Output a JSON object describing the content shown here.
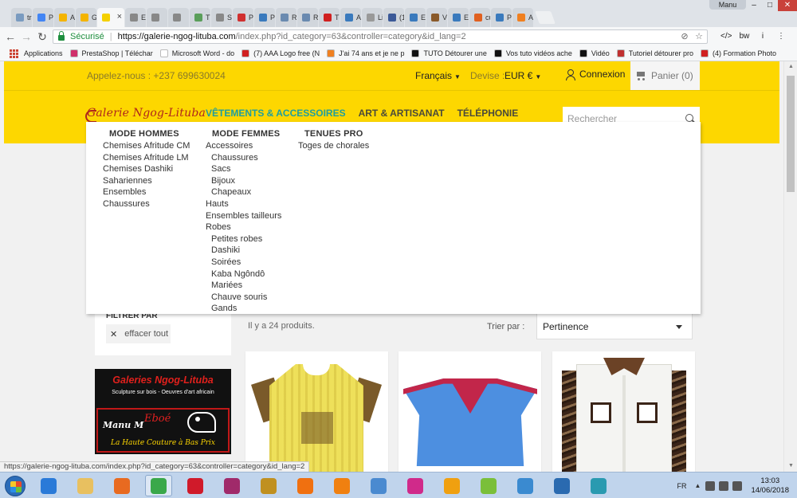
{
  "browser": {
    "tabs": [
      {
        "title": "tra",
        "color": "#7a9bc0"
      },
      {
        "title": "Pr",
        "color": "#4285f4"
      },
      {
        "title": "Ar",
        "color": "#f4b400"
      },
      {
        "title": "Ga",
        "color": "#f4b400"
      },
      {
        "title": "",
        "color": "#f4d000",
        "active": true
      },
      {
        "title": "Es",
        "color": "#888888"
      },
      {
        "title": "",
        "color": "#888888"
      },
      {
        "title": "",
        "color": "#888888"
      },
      {
        "title": "Th",
        "color": "#5a9e5a"
      },
      {
        "title": "Sa",
        "color": "#888888"
      },
      {
        "title": "Pr",
        "color": "#d03030"
      },
      {
        "title": "Pr",
        "color": "#3a7abd"
      },
      {
        "title": "Re",
        "color": "#6a8ab0"
      },
      {
        "title": "Re",
        "color": "#6a8ab0"
      },
      {
        "title": "Té",
        "color": "#d02020"
      },
      {
        "title": "Ac",
        "color": "#3a7abd"
      },
      {
        "title": "Liv",
        "color": "#999999"
      },
      {
        "title": "(1)",
        "color": "#3b5998"
      },
      {
        "title": "En",
        "color": "#3a7abd"
      },
      {
        "title": "Ve",
        "color": "#8a5a2a"
      },
      {
        "title": "En",
        "color": "#3a7abd"
      },
      {
        "title": "cu",
        "color": "#e06020"
      },
      {
        "title": "Pa",
        "color": "#3a7abd"
      },
      {
        "title": "Ai",
        "color": "#f08020"
      }
    ],
    "active_tab_close": "×",
    "user_badge": "Manu",
    "window_controls": {
      "minimize": "–",
      "maximize": "□",
      "close": "✕"
    },
    "nav": {
      "back": "←",
      "forward": "→",
      "reload": "↻"
    },
    "omnibox": {
      "secure_label": "Sécurisé",
      "separator": "|",
      "url_host": "https://galerie-ngog-lituba.com",
      "url_path": "/index.php?id_category=63&controller=category&id_lang=2"
    },
    "omnibox_icons": [
      "blocked-icon",
      "star-icon"
    ],
    "omnibox_icon_glyphs": [
      "⊘",
      "☆"
    ],
    "extensions": [
      {
        "name": "extension-code-icon",
        "glyph": "</>"
      },
      {
        "name": "extension-bw-icon",
        "glyph": "bw"
      },
      {
        "name": "extension-info-icon",
        "glyph": "i"
      },
      {
        "name": "menu-icon",
        "glyph": "⋮"
      }
    ],
    "bookmarks_apps_label": "Applications",
    "bookmarks": [
      {
        "label": "PrestaShop | Téléchar",
        "color": "#d0306a"
      },
      {
        "label": "Microsoft Word - do",
        "color": "#ffffff"
      },
      {
        "label": "(7) AAA Logo free (N",
        "color": "#d02020"
      },
      {
        "label": "J'ai 74 ans et je ne p",
        "color": "#f08020"
      },
      {
        "label": "TUTO Détourer une",
        "color": "#111111"
      },
      {
        "label": "Vos tuto vidéos ache",
        "color": "#111111"
      },
      {
        "label": "Vidéo",
        "color": "#111111"
      },
      {
        "label": "Tutoriel détourer pro",
        "color": "#c03030"
      },
      {
        "label": "(4) Formation Photo",
        "color": "#d02020"
      }
    ],
    "status_url": "https://galerie-ngog-lituba.com/index.php?id_category=63&controller=category&id_lang=2"
  },
  "site": {
    "topbar": {
      "phone": "Appelez-nous : +237 699630024",
      "language": "Français",
      "currency_label": "Devise :",
      "currency": "EUR €",
      "caret": "▼",
      "login": "Connexion",
      "cart": "Panier (0)"
    },
    "logo": {
      "text": "Galerie Ngog-Lituba"
    },
    "nav": [
      "VÊTEMENTS & ACCESSOIRES",
      "ART & ARTISANAT",
      "TÉLÉPHONIE"
    ],
    "search_placeholder": "Rechercher",
    "megamenu": {
      "columns": [
        {
          "heading": "MODE HOMMES",
          "items": [
            {
              "label": "Chemises Afritude CM",
              "sub": false
            },
            {
              "label": "Chemises Afritude LM",
              "sub": false
            },
            {
              "label": "Chemises Dashiki",
              "sub": false
            },
            {
              "label": "Sahariennes",
              "sub": false
            },
            {
              "label": "Ensembles",
              "sub": false
            },
            {
              "label": "Chaussures",
              "sub": false
            }
          ]
        },
        {
          "heading": "MODE FEMMES",
          "items": [
            {
              "label": "Accessoires",
              "sub": false
            },
            {
              "label": "Chaussures",
              "sub": true
            },
            {
              "label": "Sacs",
              "sub": true
            },
            {
              "label": "Bijoux",
              "sub": true
            },
            {
              "label": "Chapeaux",
              "sub": true
            },
            {
              "label": "Hauts",
              "sub": false
            },
            {
              "label": "Ensembles tailleurs",
              "sub": false
            },
            {
              "label": "Robes",
              "sub": false
            },
            {
              "label": "Petites robes",
              "sub": true
            },
            {
              "label": "Dashiki",
              "sub": true
            },
            {
              "label": "Soirées",
              "sub": true
            },
            {
              "label": "Kaba Ngôndô",
              "sub": true
            },
            {
              "label": "Mariées",
              "sub": true
            },
            {
              "label": "Chauve souris",
              "sub": true
            },
            {
              "label": "Gands",
              "sub": true
            }
          ]
        },
        {
          "heading": "TENUES PRO",
          "items": [
            {
              "label": "Toges de chorales",
              "sub": false
            }
          ]
        }
      ]
    },
    "filter": {
      "title": "FILTRER PAR",
      "clear_icon": "✕",
      "clear_label": "effacer tout"
    },
    "product_count": "Il y a 24 produits.",
    "sort": {
      "label": "Trier par :",
      "value": "Pertinence"
    },
    "banner": {
      "title": "Galeries Ngog-Lituba",
      "subtitle": "Sculpture sur bois - Oeuvres d'art africain",
      "name": "Manu M",
      "mark": "Eboé",
      "tagline": "La Haute Couture à Bas Prix"
    }
  },
  "taskbar": {
    "apps": [
      {
        "name": "ie-taskbar-icon",
        "color": "#2a7ad8"
      },
      {
        "name": "explorer-taskbar-icon",
        "color": "#e8c060"
      },
      {
        "name": "firefox-taskbar-icon",
        "color": "#e86a20"
      },
      {
        "name": "chrome-taskbar-icon",
        "color": "#3aa84a",
        "active": true
      },
      {
        "name": "opera-taskbar-icon",
        "color": "#d01a2a"
      },
      {
        "name": "winrar-taskbar-icon",
        "color": "#a02a6a"
      },
      {
        "name": "studio-taskbar-icon",
        "color": "#c09020"
      },
      {
        "name": "orange-taskbar-icon",
        "color": "#f07010"
      },
      {
        "name": "vlc-taskbar-icon",
        "color": "#f08010"
      },
      {
        "name": "paint-taskbar-icon",
        "color": "#4a8ad0"
      },
      {
        "name": "app-pink-taskbar-icon",
        "color": "#d02a8a"
      },
      {
        "name": "app-orange-taskbar-icon",
        "color": "#f0a010"
      },
      {
        "name": "picasa-taskbar-icon",
        "color": "#7abf3a"
      },
      {
        "name": "snipping-taskbar-icon",
        "color": "#3a8ad0"
      },
      {
        "name": "app-blue-taskbar-icon",
        "color": "#2a6ab0"
      },
      {
        "name": "app-teal-taskbar-icon",
        "color": "#2a9ab0"
      }
    ],
    "language": "FR",
    "tray_arrow": "▲",
    "time": "13:03",
    "date": "14/06/2018"
  }
}
